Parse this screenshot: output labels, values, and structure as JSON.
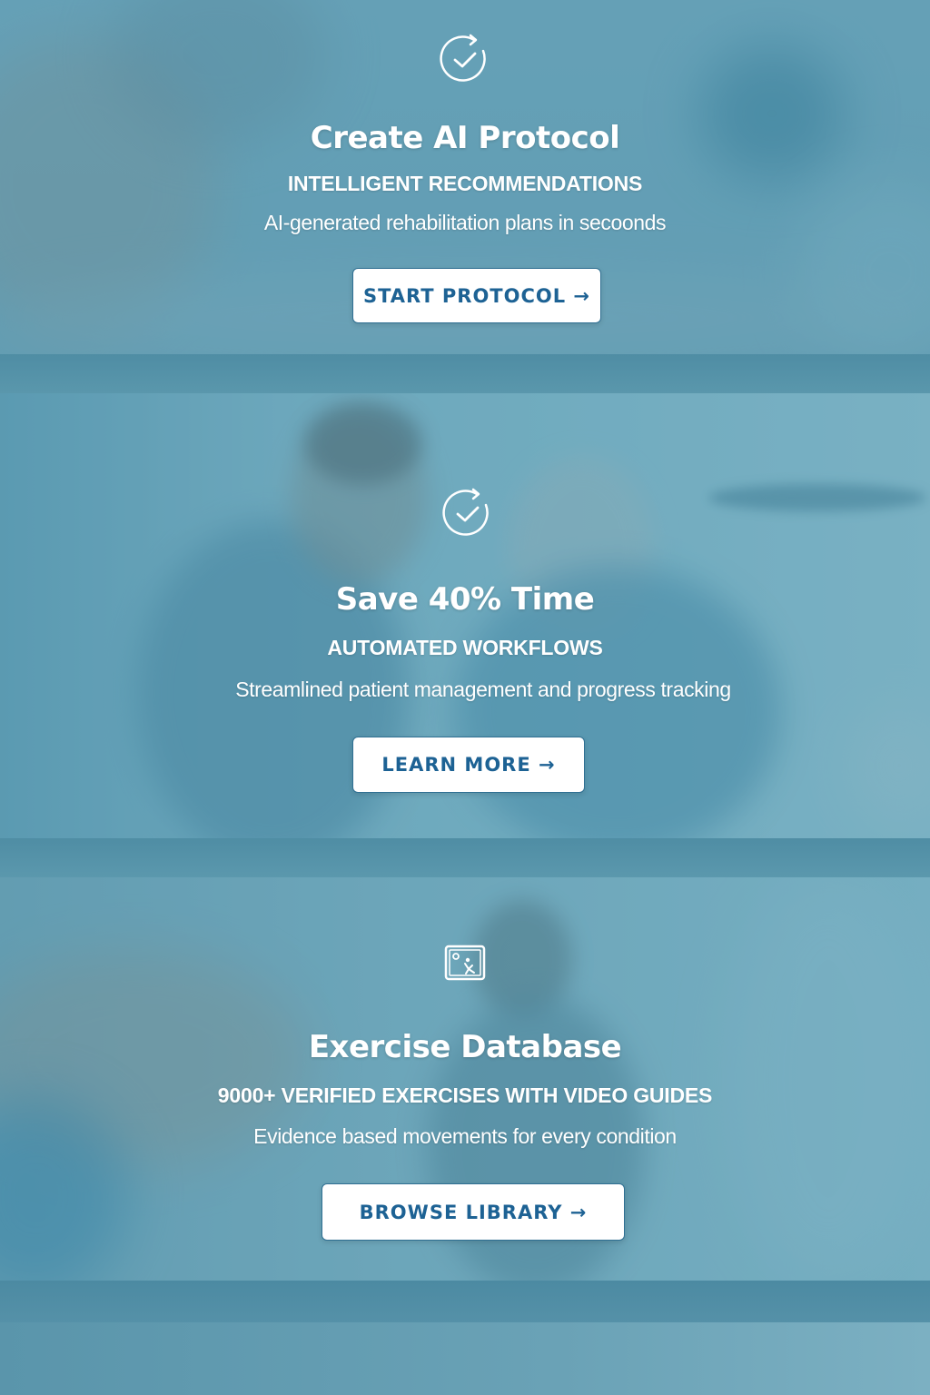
{
  "cards": [
    {
      "icon": "refresh-check-icon",
      "title": "Create AI Protocol",
      "subtitle": "INTELLIGENT RECOMMENDATIONS",
      "description": "AI-generated rehabilitation plans in secoonds",
      "button_label": "START PROTOCOL →"
    },
    {
      "icon": "refresh-check-icon",
      "title": "Save 40% Time",
      "subtitle": "AUTOMATED WORKFLOWS",
      "description": "Streamlined patient management and progress tracking",
      "button_label": "LEARN MORE →"
    },
    {
      "icon": "video-library-icon",
      "title": "Exercise Database",
      "subtitle": "9000+ VERIFIED EXERCISES WITH VIDEO GUIDES",
      "description": "Evidence based movements for every condition",
      "button_label": "BROWSE LIBRARY →"
    }
  ],
  "colors": {
    "overlay": "#5d98ad",
    "button_text": "#1d6294",
    "button_bg": "#ffffff",
    "text": "#ffffff"
  }
}
